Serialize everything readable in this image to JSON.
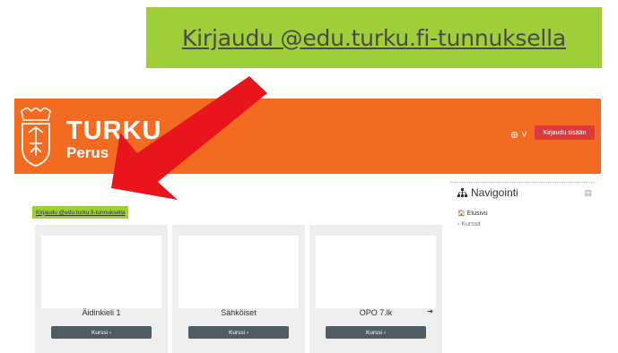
{
  "callout": {
    "link_text": "Kirjaudu @edu.turku.fi-tunnuksella"
  },
  "header": {
    "brand_top": "TURKU",
    "brand_bottom": "Perus",
    "globe_label": "⊕ ˅",
    "login_button": "Kirjaudu sisään"
  },
  "main": {
    "login_link": "Kirjaudu @edu.turku.fi-tunnuksella"
  },
  "courses": [
    {
      "name": "Äidinkieli 1",
      "button": "Kurssi ›"
    },
    {
      "name": "Sähköiset",
      "button": "Kurssi ›"
    },
    {
      "name": "OPO 7.lk",
      "button": "Kurssi ›"
    }
  ],
  "navigation": {
    "title": "Navigointi",
    "home": "Etusivu",
    "courses": "Kurssit"
  },
  "colors": {
    "header": "#f26b21",
    "callout": "#9ecf38",
    "login_button": "#dd3b3b",
    "course_button": "#4f5b63",
    "arrow": "#e8161c"
  }
}
